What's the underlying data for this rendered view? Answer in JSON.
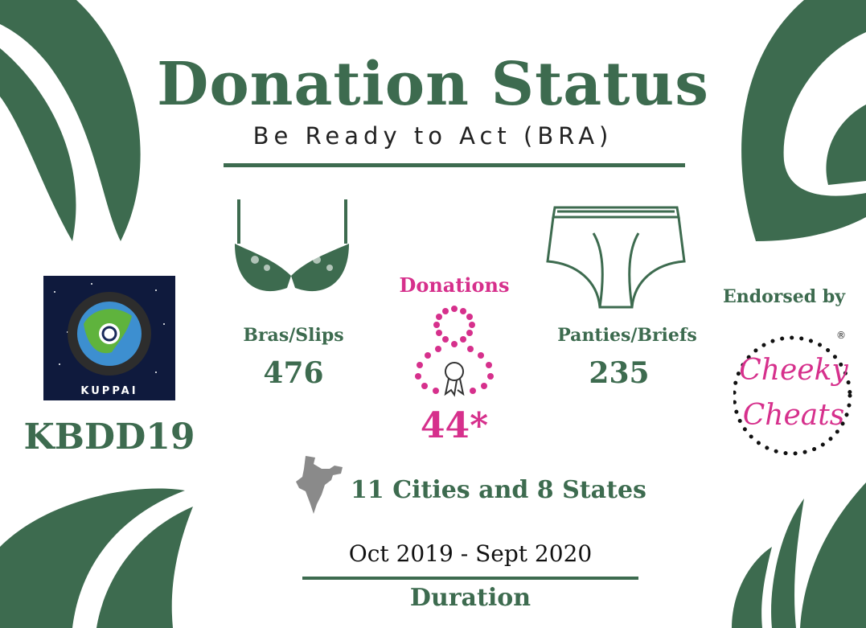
{
  "title": "Donation Status",
  "subtitle": "Be Ready to Act (BRA)",
  "items": {
    "bras": {
      "label": "Bras/Slips",
      "count": "476",
      "icon": "bra-icon"
    },
    "panties": {
      "label": "Panties/Briefs",
      "count": "235",
      "icon": "briefs-icon"
    }
  },
  "donations": {
    "label": "Donations",
    "count": "44*",
    "icon": "award-ribbon-icon"
  },
  "org": {
    "logo_text": "KUPPAI",
    "code": "KBDD19"
  },
  "endorsement": {
    "label": "Endorsed by",
    "brand_line1": "Cheeky",
    "brand_line2": "Cheats",
    "registered": "®"
  },
  "reach": {
    "text": "11 Cities and 8 States",
    "icon": "india-map-icon"
  },
  "period": {
    "dates": "Oct 2019 - Sept 2020",
    "label": "Duration"
  },
  "colors": {
    "green": "#3d6b4f",
    "pink": "#d6308c",
    "navy": "#0f1a3d"
  }
}
